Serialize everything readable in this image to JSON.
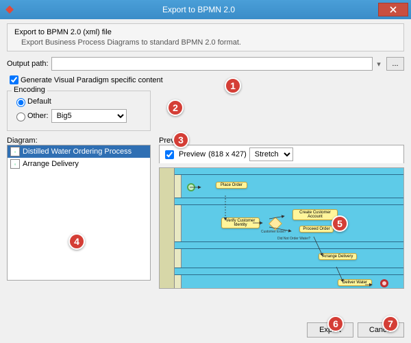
{
  "window": {
    "title": "Export to BPMN 2.0"
  },
  "header": {
    "title": "Export to BPMN 2.0 (xml) file",
    "desc": "Export Business Process Diagrams to standard BPMN 2.0 format."
  },
  "output": {
    "label": "Output path:",
    "value": "",
    "browse": "..."
  },
  "generate_specific": {
    "label": "Generate Visual Paradigm specific content",
    "checked": true
  },
  "encoding": {
    "legend": "Encoding",
    "default_label": "Default",
    "other_label": "Other:",
    "selected": "default",
    "other_value": "Big5"
  },
  "diagram": {
    "label": "Diagram:",
    "items": [
      {
        "name": "Distilled Water Ordering Process",
        "selected": true
      },
      {
        "name": "Arrange Delivery",
        "selected": false
      }
    ]
  },
  "preview": {
    "label": "Preview",
    "check_label": "Preview",
    "checked": true,
    "dims": "(818 x 427)",
    "mode": "Stretch",
    "nodes": {
      "place_order": "Place Order",
      "verify": "Verify Customer Identity",
      "create_acct": "Create Customer Account",
      "proceed": "Proceed Order",
      "arrange": "Arrange Delivery",
      "deliver": "Deliver Water",
      "q1": "Customer Exist?",
      "q2": "Did Not Order Water?"
    }
  },
  "buttons": {
    "export": "Export",
    "cancel": "Cancel"
  },
  "annotations": [
    "1",
    "2",
    "3",
    "4",
    "5",
    "6",
    "7"
  ]
}
